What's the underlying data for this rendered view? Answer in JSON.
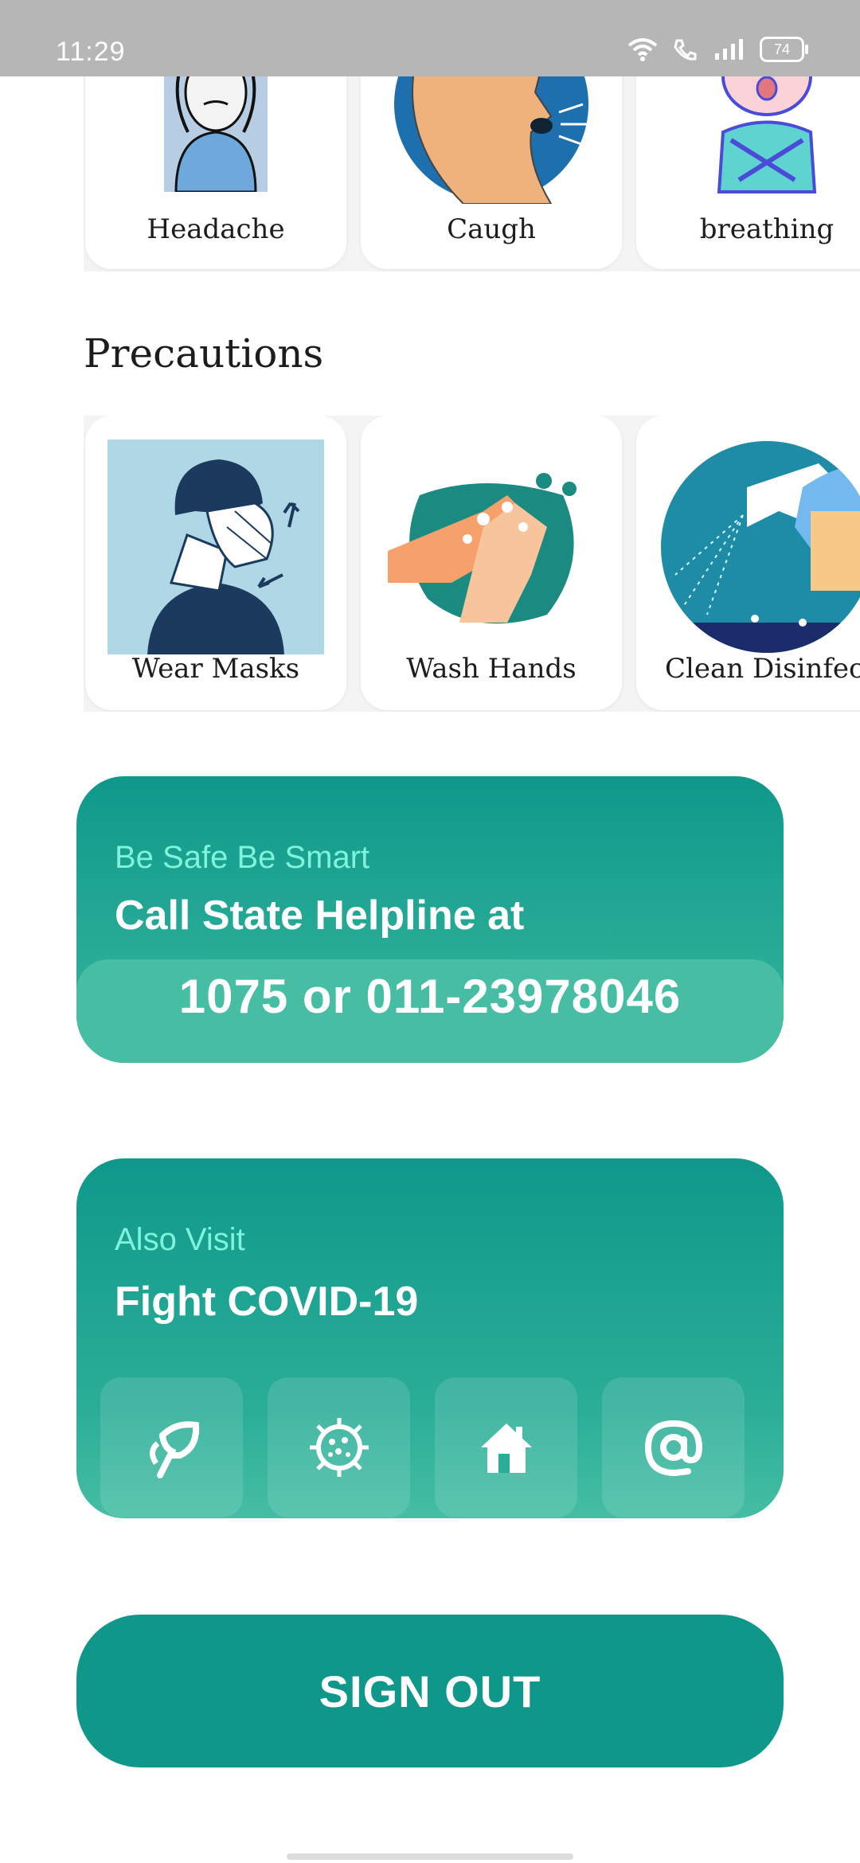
{
  "status_bar": {
    "time": "11:29",
    "battery": "74"
  },
  "symptoms": [
    {
      "label": "Headache"
    },
    {
      "label": "Caugh"
    },
    {
      "label": "breathing"
    }
  ],
  "precautions": {
    "title": "Precautions",
    "items": [
      {
        "label": "Wear Masks"
      },
      {
        "label": "Wash Hands"
      },
      {
        "label": "Clean Disinfect"
      }
    ]
  },
  "helpline": {
    "kicker": "Be Safe Be Smart",
    "heading": "Call State Helpline at",
    "number": "1075 or 011-23978046"
  },
  "visit": {
    "kicker": "Also Visit",
    "heading": "Fight COVID-19",
    "links": [
      {
        "icon": "leaf-icon"
      },
      {
        "icon": "virus-icon"
      },
      {
        "icon": "home-icon"
      },
      {
        "icon": "at-sign-icon"
      }
    ]
  },
  "signout": {
    "label": "SIGN OUT"
  },
  "colors": {
    "teal": "#0f978a",
    "teal_light": "#47bea4",
    "accent_text": "#7ff3db"
  }
}
